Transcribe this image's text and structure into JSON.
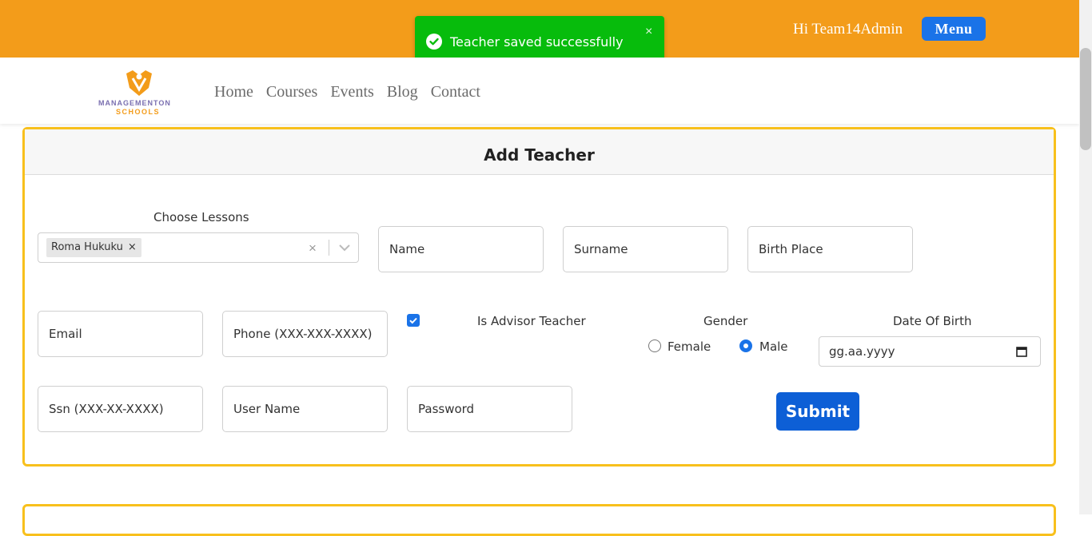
{
  "topbar": {
    "greeting": "Hi Team14Admin",
    "menu_label": "Menu"
  },
  "toast": {
    "message": "Teacher saved successfully",
    "close": "×",
    "icon": "check-circle-icon"
  },
  "brand": {
    "line1": "MANAGEMENTON",
    "line2": "SCHOOLS"
  },
  "nav": {
    "items": [
      "Home",
      "Courses",
      "Events",
      "Blog",
      "Contact"
    ]
  },
  "form": {
    "title": "Add Teacher",
    "lessons_label": "Choose Lessons",
    "selected_lesson": "Roma Hukuku",
    "chip_remove": "×",
    "clear": "×",
    "name_placeholder": "Name",
    "surname_placeholder": "Surname",
    "birth_place_placeholder": "Birth Place",
    "email_placeholder": "Email",
    "phone_placeholder": "Phone (XXX-XXX-XXXX)",
    "advisor_label": "Is Advisor Teacher",
    "advisor_checked": true,
    "gender_label": "Gender",
    "gender_female": "Female",
    "gender_male": "Male",
    "gender_selected": "Male",
    "dob_label": "Date Of Birth",
    "dob_placeholder": "gg.aa.yyyy",
    "ssn_placeholder": "Ssn (XXX-XX-XXXX)",
    "username_placeholder": "User Name",
    "password_placeholder": "Password",
    "submit_label": "Submit"
  },
  "colors": {
    "topbar": "#f39c1a",
    "toast": "#07bc0c",
    "accent": "#1a73e8",
    "card_border": "#f8c01c"
  }
}
